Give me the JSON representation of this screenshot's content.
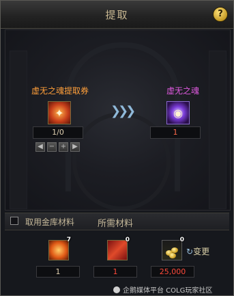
{
  "dialog": {
    "title": "提取",
    "help_label": "?"
  },
  "extract": {
    "source_item": {
      "name": "虚无之魂提取券",
      "icon": "soul-extraction-ticket-icon",
      "quantity": "1/0"
    },
    "target_item": {
      "name": "虚无之魂",
      "icon": "void-soul-icon",
      "quantity": "1"
    },
    "arrow_icon": "triple-chevron-right-icon",
    "stepper": [
      "◀",
      "−",
      "+",
      "▶"
    ]
  },
  "materials": {
    "use_bank_label": "取用金库材料",
    "use_bank_checked": false,
    "required_label": "所需材料",
    "exchange_label": "变更",
    "items": [
      {
        "icon": "fire-orb-icon",
        "badge": "7",
        "value": "1"
      },
      {
        "icon": "red-crystal-icon",
        "badge": "0",
        "value": "1"
      },
      {
        "icon": "gold-coins-icon",
        "badge": "0",
        "value": "25,000"
      }
    ]
  },
  "watermark": {
    "text": "企鹅媒体平台 COLG玩家社区"
  },
  "colors": {
    "source_name": "#ff9f3a",
    "target_name": "#e05ae0",
    "insufficient": "#ff4a3a"
  }
}
